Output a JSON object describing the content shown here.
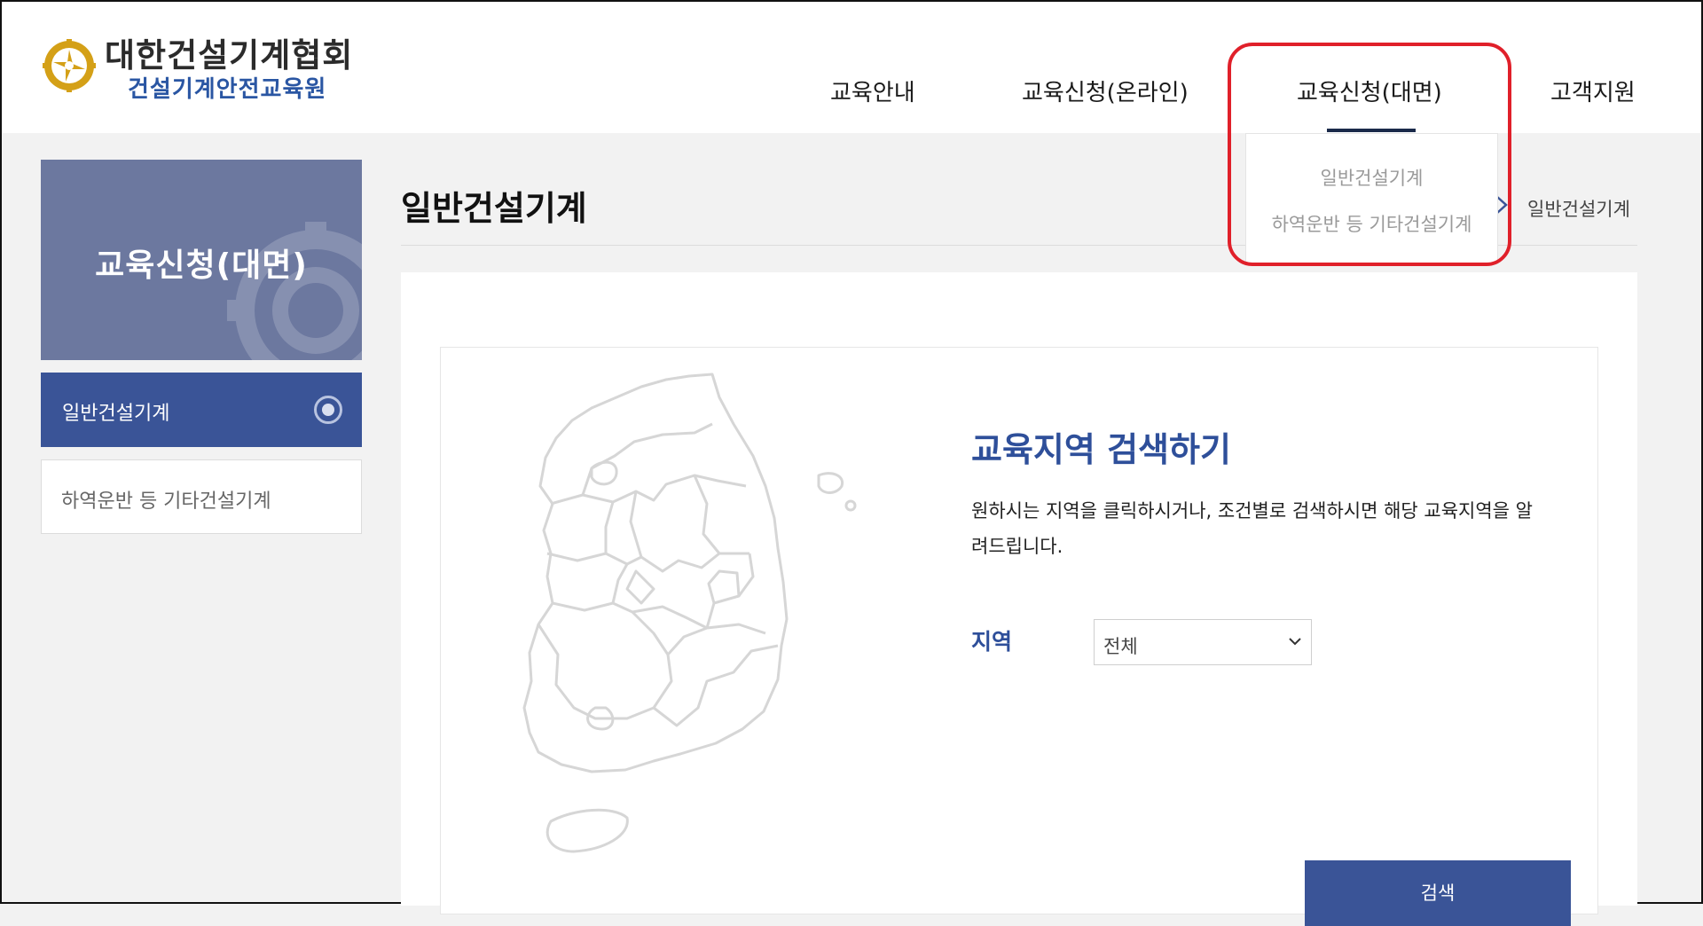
{
  "header": {
    "logo_main": "대한건설기계협회",
    "logo_sub": "건설기계안전교육원",
    "nav": [
      {
        "label": "교육안내"
      },
      {
        "label": "교육신청(온라인)"
      },
      {
        "label": "교육신청(대면)"
      },
      {
        "label": "고객지원"
      }
    ]
  },
  "dropdown": {
    "items": [
      {
        "label": "일반건설기계"
      },
      {
        "label": "하역운반 등 기타건설기계"
      }
    ]
  },
  "sidebar": {
    "hero_title": "교육신청(대면)",
    "items": [
      {
        "label": "일반건설기계",
        "active": true
      },
      {
        "label": "하역운반 등 기타건설기계",
        "active": false
      }
    ]
  },
  "main": {
    "page_title": "일반건설기계",
    "breadcrumb_current": "일반건설기계",
    "search": {
      "title": "교육지역 검색하기",
      "description": "원하시는 지역을 클릭하시거나, 조건별로 검색하시면 해당 교육지역을 알려드립니다.",
      "region_label": "지역",
      "region_selected": "전체",
      "button_label": "검색"
    }
  },
  "colors": {
    "primary": "#3a5497",
    "accent_text": "#2e4f9a",
    "highlight": "#e0202a",
    "hero_bg": "#6c789f"
  },
  "icons": [
    "logo-emblem-icon",
    "radio-selected-icon",
    "chevron-right-icon",
    "chevron-down-icon",
    "korea-map-icon"
  ]
}
